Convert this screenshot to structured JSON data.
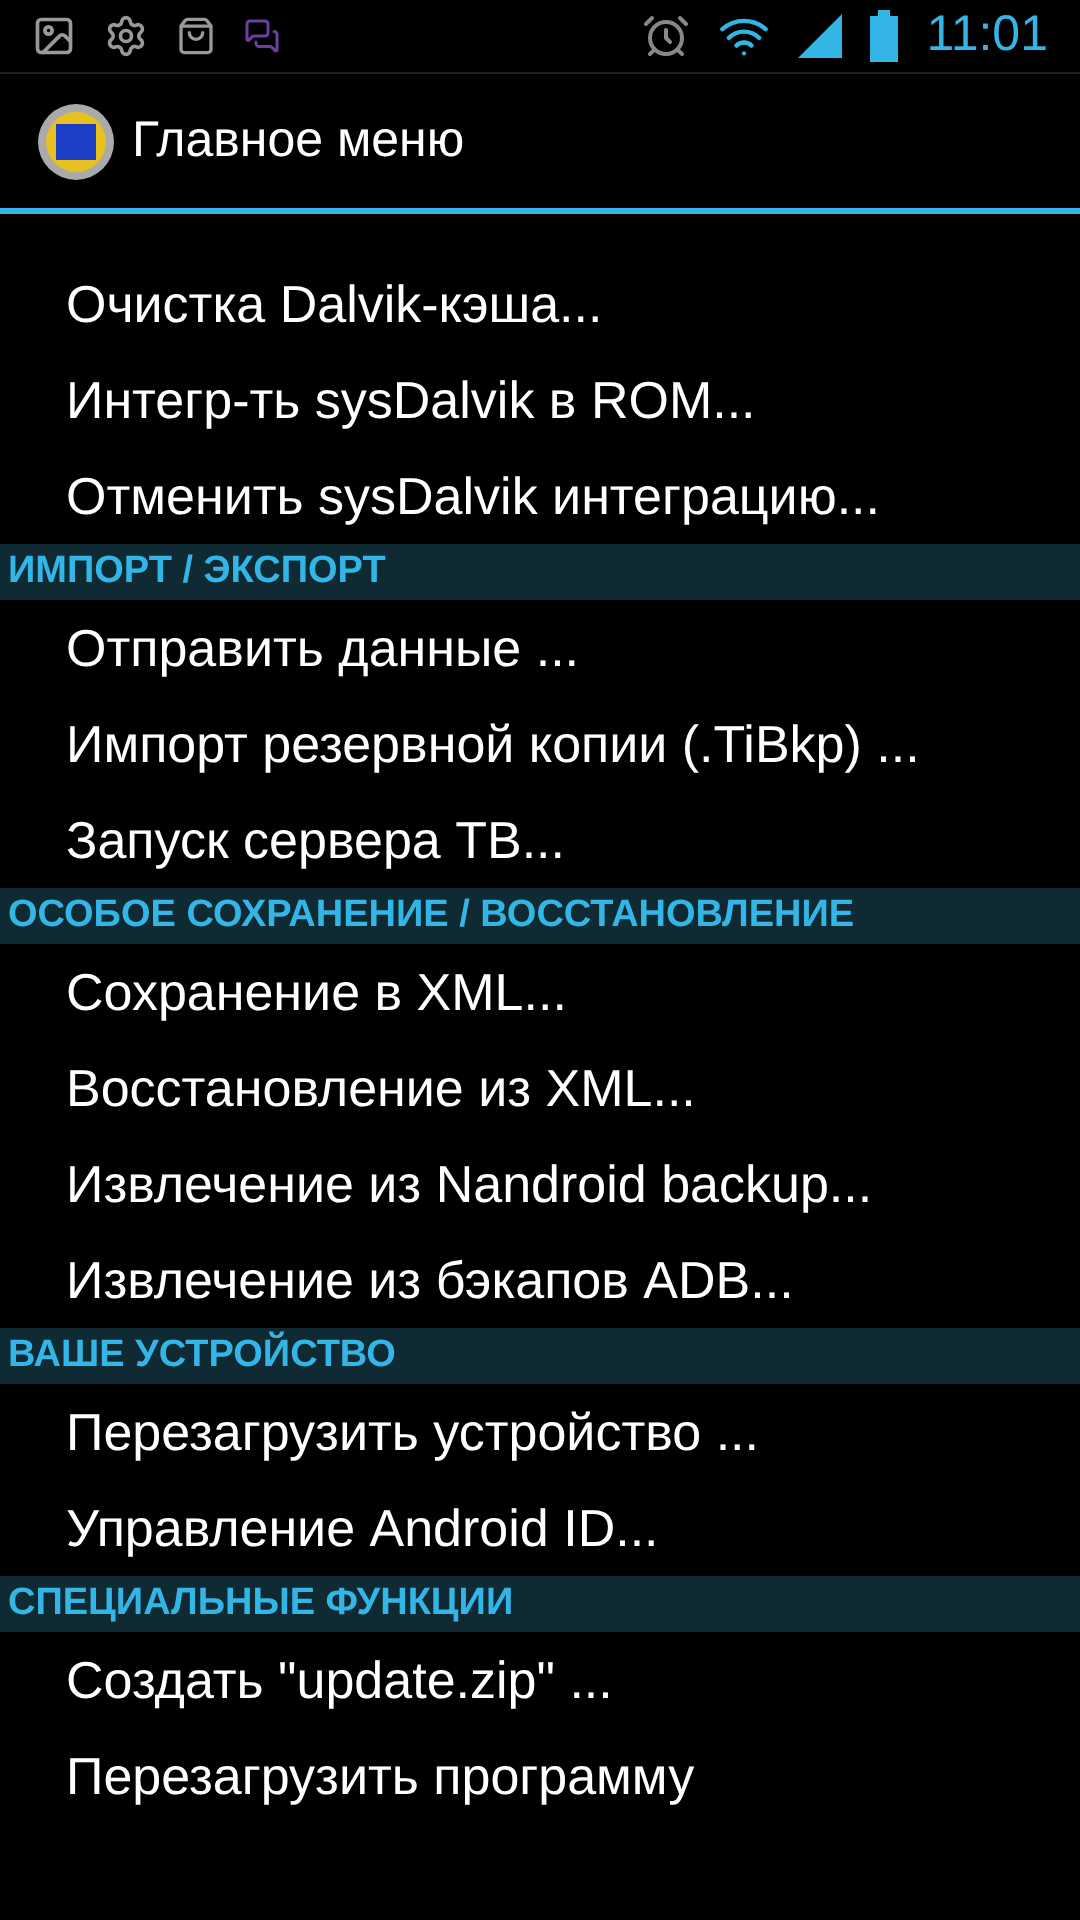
{
  "status_bar": {
    "time": "11:01"
  },
  "action_bar": {
    "title": "Главное меню"
  },
  "list": [
    {
      "kind": "item",
      "label": "Очистка Dalvik-кэша..."
    },
    {
      "kind": "item",
      "label": "Интегр-ть sysDalvik в ROM..."
    },
    {
      "kind": "item",
      "label": "Отменить sysDalvik интеграцию..."
    },
    {
      "kind": "header",
      "label": "ИМПОРТ / ЭКСПОРТ"
    },
    {
      "kind": "item",
      "label": "Отправить данные ..."
    },
    {
      "kind": "item",
      "label": "Импорт резервной копии (.TiBkp) ..."
    },
    {
      "kind": "item",
      "label": "Запуск сервера ТВ..."
    },
    {
      "kind": "header",
      "label": "ОСОБОЕ СОХРАНЕНИЕ / ВОССТАНОВЛЕНИЕ"
    },
    {
      "kind": "item",
      "label": "Сохранение в XML..."
    },
    {
      "kind": "item",
      "label": "Восстановление из XML..."
    },
    {
      "kind": "item",
      "label": "Извлечение из Nandroid backup..."
    },
    {
      "kind": "item",
      "label": "Извлечение из бэкапов ADB..."
    },
    {
      "kind": "header",
      "label": "ВАШЕ УСТРОЙСТВО"
    },
    {
      "kind": "item",
      "label": "Перезагрузить устройство ..."
    },
    {
      "kind": "item",
      "label": "Управление Android ID..."
    },
    {
      "kind": "header",
      "label": "СПЕЦИАЛЬНЫЕ ФУНКЦИИ"
    },
    {
      "kind": "item",
      "label": "Создать \"update.zip\" ..."
    },
    {
      "kind": "item",
      "label": "Перезагрузить программу"
    }
  ]
}
